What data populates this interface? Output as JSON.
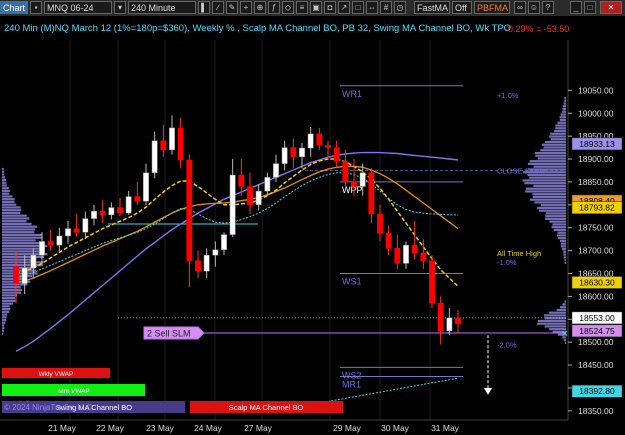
{
  "toolbar": {
    "chart_label": "Chart",
    "instrument": "MNQ 06-24",
    "interval": "240 Minute",
    "study1": "FastMA",
    "toggle": "Off",
    "study2": "PBFMA"
  },
  "header": {
    "title": "240 Min (M)NQ March 12 (1%=180p=$360), Weekly % , Scalp MA Channel BO, PB 32, Swing MA Channel BO, Wk TPO",
    "pnl": "-0.29% = -53.50"
  },
  "colors": {
    "background": "#000000",
    "bull_candle": "#ffffff",
    "bear_candle": "#ff0000",
    "dark_candle": "#1a1a1a",
    "profile": "#8a82d8",
    "ma_fast": "#f0d000",
    "ma_slow": "#e89000",
    "ma_long": "#8a6ff0",
    "ma_cyan": "#40d8e8",
    "level_line": "#7a73c8",
    "text_blue": "#6f6fe0",
    "header_cyan": "#40e0ff"
  },
  "chart_data": {
    "type": "candlestick",
    "y_axis": {
      "min": 18330,
      "max": 19160,
      "ticks": [
        19050,
        19000,
        18950,
        18900,
        18850,
        18800,
        18750,
        18700,
        18650,
        18600,
        18550,
        18500,
        18450,
        18400,
        18350
      ]
    },
    "x_axis": {
      "labels": [
        "21 May",
        "22 May",
        "23 May",
        "24 May",
        "27 May",
        "29 May",
        "30 May",
        "31 May"
      ]
    },
    "candles": [
      {
        "o": 18665,
        "h": 18700,
        "l": 18585,
        "c": 18628
      },
      {
        "o": 18628,
        "h": 18690,
        "l": 18605,
        "c": 18662
      },
      {
        "o": 18662,
        "h": 18705,
        "l": 18640,
        "c": 18690
      },
      {
        "o": 18690,
        "h": 18740,
        "l": 18670,
        "c": 18720
      },
      {
        "o": 18720,
        "h": 18745,
        "l": 18700,
        "c": 18712
      },
      {
        "o": 18712,
        "h": 18750,
        "l": 18695,
        "c": 18732
      },
      {
        "o": 18732,
        "h": 18765,
        "l": 18715,
        "c": 18748
      },
      {
        "o": 18748,
        "h": 18780,
        "l": 18730,
        "c": 18740
      },
      {
        "o": 18740,
        "h": 18785,
        "l": 18725,
        "c": 18770
      },
      {
        "o": 18770,
        "h": 18800,
        "l": 18755,
        "c": 18786
      },
      {
        "o": 18786,
        "h": 18810,
        "l": 18760,
        "c": 18778
      },
      {
        "o": 18778,
        "h": 18805,
        "l": 18768,
        "c": 18794
      },
      {
        "o": 18794,
        "h": 18815,
        "l": 18775,
        "c": 18782
      },
      {
        "o": 18782,
        "h": 18830,
        "l": 18778,
        "c": 18818
      },
      {
        "o": 18818,
        "h": 18850,
        "l": 18800,
        "c": 18808
      },
      {
        "o": 18808,
        "h": 18890,
        "l": 18800,
        "c": 18870
      },
      {
        "o": 18870,
        "h": 18960,
        "l": 18858,
        "c": 18940
      },
      {
        "o": 18940,
        "h": 18975,
        "l": 18905,
        "c": 18920
      },
      {
        "o": 18920,
        "h": 18995,
        "l": 18910,
        "c": 18968
      },
      {
        "o": 18968,
        "h": 18990,
        "l": 18880,
        "c": 18898
      },
      {
        "o": 18898,
        "h": 18910,
        "l": 18620,
        "c": 18678
      },
      {
        "o": 18678,
        "h": 18700,
        "l": 18640,
        "c": 18655
      },
      {
        "o": 18655,
        "h": 18705,
        "l": 18640,
        "c": 18690
      },
      {
        "o": 18690,
        "h": 18720,
        "l": 18665,
        "c": 18702
      },
      {
        "o": 18702,
        "h": 18740,
        "l": 18690,
        "c": 18735
      },
      {
        "o": 18735,
        "h": 18900,
        "l": 18730,
        "c": 18865
      },
      {
        "o": 18865,
        "h": 18900,
        "l": 18820,
        "c": 18840
      },
      {
        "o": 18840,
        "h": 18870,
        "l": 18780,
        "c": 18800
      },
      {
        "o": 18800,
        "h": 18845,
        "l": 18788,
        "c": 18830
      },
      {
        "o": 18830,
        "h": 18870,
        "l": 18820,
        "c": 18860
      },
      {
        "o": 18860,
        "h": 18910,
        "l": 18850,
        "c": 18890
      },
      {
        "o": 18890,
        "h": 18940,
        "l": 18875,
        "c": 18925
      },
      {
        "o": 18925,
        "h": 18945,
        "l": 18880,
        "c": 18905
      },
      {
        "o": 18905,
        "h": 18935,
        "l": 18880,
        "c": 18924
      },
      {
        "o": 18924,
        "h": 18970,
        "l": 18905,
        "c": 18955
      },
      {
        "o": 18955,
        "h": 18968,
        "l": 18920,
        "c": 18930
      },
      {
        "o": 18930,
        "h": 18940,
        "l": 18900,
        "c": 18925
      },
      {
        "o": 18925,
        "h": 18940,
        "l": 18880,
        "c": 18895
      },
      {
        "o": 18895,
        "h": 18920,
        "l": 18840,
        "c": 18850
      },
      {
        "o": 18850,
        "h": 18900,
        "l": 18820,
        "c": 18840
      },
      {
        "o": 18840,
        "h": 18890,
        "l": 18820,
        "c": 18870
      },
      {
        "o": 18870,
        "h": 18880,
        "l": 18760,
        "c": 18780
      },
      {
        "o": 18780,
        "h": 18800,
        "l": 18720,
        "c": 18738
      },
      {
        "o": 18738,
        "h": 18755,
        "l": 18690,
        "c": 18705
      },
      {
        "o": 18705,
        "h": 18735,
        "l": 18660,
        "c": 18672
      },
      {
        "o": 18672,
        "h": 18720,
        "l": 18660,
        "c": 18712
      },
      {
        "o": 18712,
        "h": 18765,
        "l": 18680,
        "c": 18695
      },
      {
        "o": 18695,
        "h": 18725,
        "l": 18660,
        "c": 18678
      },
      {
        "o": 18678,
        "h": 18690,
        "l": 18575,
        "c": 18585
      },
      {
        "o": 18585,
        "h": 18600,
        "l": 18495,
        "c": 18525
      },
      {
        "o": 18525,
        "h": 18575,
        "l": 18515,
        "c": 18553
      },
      {
        "o": 18553,
        "h": 18570,
        "l": 18520,
        "c": 18540
      }
    ],
    "ma_fast": [
      18650,
      18655,
      18662,
      18672,
      18684,
      18696,
      18708,
      18718,
      18728,
      18738,
      18748,
      18756,
      18764,
      18772,
      18782,
      18795,
      18812,
      18828,
      18842,
      18852,
      18852,
      18840,
      18826,
      18812,
      18800,
      18800,
      18802,
      18804,
      18810,
      18820,
      18832,
      18848,
      18862,
      18876,
      18888,
      18896,
      18900,
      18900,
      18894,
      18884,
      18872,
      18856,
      18836,
      18812,
      18786,
      18760,
      18734,
      18708,
      18682,
      18658,
      18640,
      18622
    ],
    "ma_slow": [
      18630,
      18634,
      18640,
      18648,
      18656,
      18665,
      18674,
      18683,
      18692,
      18701,
      18710,
      18718,
      18726,
      18734,
      18742,
      18752,
      18762,
      18772,
      18782,
      18790,
      18796,
      18800,
      18802,
      18803,
      18804,
      18806,
      18809,
      18812,
      18816,
      18822,
      18829,
      18837,
      18846,
      18855,
      18864,
      18872,
      18878,
      18882,
      18884,
      18884,
      18882,
      18876,
      18868,
      18858,
      18846,
      18832,
      18818,
      18804,
      18790,
      18776,
      18762,
      18748
    ],
    "ma_long": [
      18480,
      18490,
      18502,
      18516,
      18530,
      18545,
      18560,
      18576,
      18592,
      18608,
      18624,
      18640,
      18656,
      18672,
      18688,
      18704,
      18718,
      18732,
      18746,
      18758,
      18770,
      18782,
      18792,
      18802,
      18812,
      18820,
      18828,
      18836,
      18844,
      18852,
      18860,
      18868,
      18876,
      18884,
      18892,
      18898,
      18904,
      18908,
      18911,
      18913,
      18914,
      18914,
      18914,
      18913,
      18912,
      18910,
      18908,
      18906,
      18904,
      18902,
      18900,
      18898
    ],
    "ma_cyan": [
      18640,
      18645,
      18652,
      18660,
      18668,
      18676,
      18684,
      18692,
      18700,
      18708,
      18716,
      18722,
      18728,
      18734,
      18740,
      18748,
      18758,
      18770,
      18782,
      18792,
      18790,
      18780,
      18770,
      18762,
      18760,
      18762,
      18768,
      18774,
      18782,
      18792,
      18804,
      18818,
      18830,
      18842,
      18852,
      18860,
      18866,
      18870,
      18870,
      18866,
      18858,
      18846,
      18830,
      18814,
      18800,
      18790,
      18784,
      18782,
      18780,
      18779,
      18778,
      18778
    ],
    "levels": [
      {
        "label": "WR1",
        "value": 19060
      },
      {
        "label": "WPP",
        "value": 18850
      },
      {
        "label": "WS1",
        "value": 18650
      },
      {
        "label": "WS2",
        "value": 18445
      },
      {
        "label": "MR1",
        "value": 18425
      }
    ],
    "annotations": [
      {
        "text": "+1.0%",
        "value": 19040
      },
      {
        "text": "CLOSE 1 MAY",
        "value": 18875
      },
      {
        "text": "All Time High",
        "value": 18695
      },
      {
        "text": "-1.0%",
        "value": 18675
      },
      {
        "text": "-2.0%",
        "value": 18495
      }
    ],
    "price_tags": [
      {
        "text": "18933.13",
        "value": 18933.13
      },
      {
        "text": "18808.40",
        "value": 18808.4
      },
      {
        "text": "18793.82",
        "value": 18793.82
      },
      {
        "text": "18630.30",
        "value": 18630.3
      },
      {
        "text": "18553.00",
        "value": 18553.0
      },
      {
        "text": "18524.75",
        "value": 18524.75
      },
      {
        "text": "18392.80",
        "value": 18392.8
      }
    ],
    "order_label": "2 Sell SLM",
    "order_value": 18520,
    "close_value": 18553
  },
  "legend": {
    "weekly_vwap": "Wkly VWAP",
    "monthly_vwap": "Mnt VWAP",
    "swing": "Swing MA Channel BO",
    "scalp": "Scalp MA Channel BO",
    "copyright": "© 2024 NinjaTrader, LLC"
  }
}
